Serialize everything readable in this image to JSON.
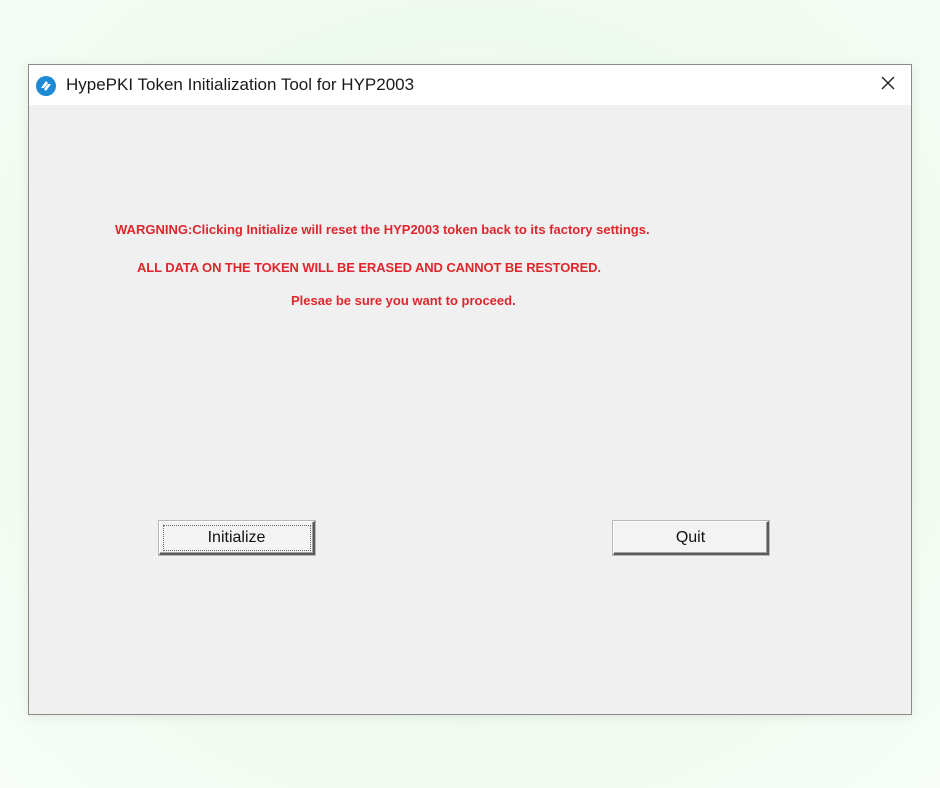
{
  "window": {
    "title": "HypePKI Token Initialization Tool for HYP2003",
    "app_icon": "hypepki-logo-icon",
    "close_icon": "close-icon"
  },
  "warning": {
    "line1": "WARGNING:Clicking Initialize will reset the HYP2003 token back to its factory settings.",
    "line2": "ALL DATA ON THE TOKEN WILL BE ERASED AND CANNOT BE RESTORED.",
    "line3": "Plesae be sure you want to proceed.",
    "color": "#e0262d"
  },
  "buttons": {
    "initialize_label": "Initialize",
    "quit_label": "Quit"
  }
}
